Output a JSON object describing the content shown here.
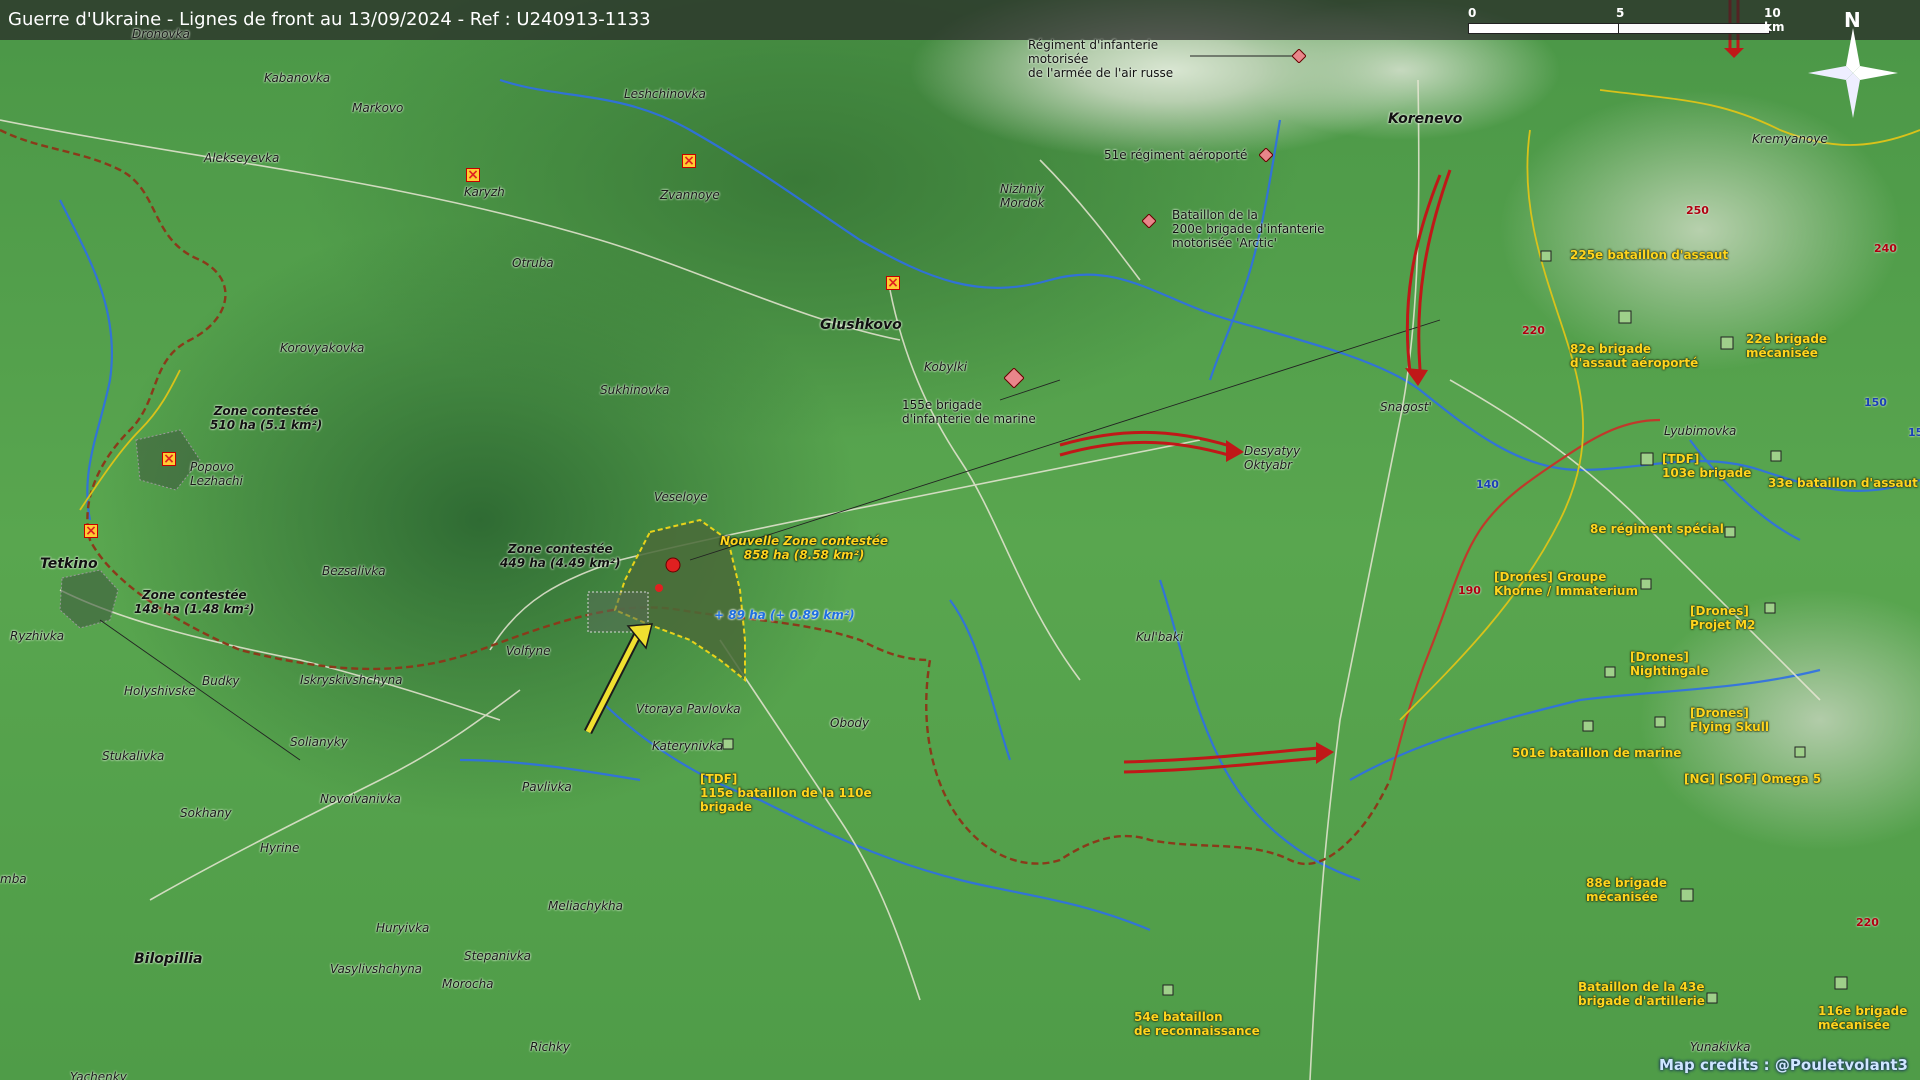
{
  "title": "Guerre d'Ukraine - Lignes de front au 13/09/2024 - Ref : U240913-1133",
  "scale": {
    "t0": "0",
    "t5": "5",
    "t10": "10 km"
  },
  "compass": {
    "label": "N"
  },
  "credit": "Map credits : @Pouletvolant3",
  "places": {
    "dronovka": "Dronovka",
    "kabanovka": "Kabanovka",
    "markovo": "Markovo",
    "leshchinovka": "Leshchinovka",
    "alekseyevka": "Alekseyevka",
    "karyzh": "Karyzh",
    "zvannoye": "Zvannoye",
    "otruba": "Otruba",
    "korovyakovka": "Korovyakovka",
    "glushkovo": "Glushkovo",
    "kobylki": "Kobylki",
    "sukhinovka": "Sukhinovka",
    "popovo": "Popovo\nLezhachi",
    "tetkino": "Tetkino",
    "ryzhivka": "Ryzhivka",
    "bezsalivka": "Bezsalivka",
    "veseloye": "Veseloye",
    "volfyne": "Volfyne",
    "holyshivske": "Holyshivske",
    "budky": "Budky",
    "iskryskivshchyna": "Iskryskivshchyna",
    "vtoraya": "Vtoraya Pavlovka",
    "katerynivka": "Katerynivka",
    "obody": "Obody",
    "solianyky": "Solianyky",
    "stukalivka": "Stukalivka",
    "pavlivka": "Pavlivka",
    "novoivanivka": "Novoivanivka",
    "sokhany": "Sokhany",
    "hyrine": "Hyrine",
    "meliachykha": "Meliachykha",
    "huryivka": "Huryivka",
    "bilopillia": "Bilopillia",
    "stepanivka": "Stepanivka",
    "vasylivshchyna": "Vasylivshchyna",
    "morocha": "Morocha",
    "richky": "Richky",
    "yachenky": "Yachenky",
    "mba": "mba",
    "korenevo": "Korenevo",
    "kremyanoye": "Kremyanoye",
    "nizhniy": "Nizhniy\nMordok",
    "snagost": "Snagost'",
    "desyatyy": "Desyatyy\nOktyabr",
    "lyubimovka": "Lyubimovka",
    "kulbaki": "Kul'baki",
    "yunakivka": "Yunakivka"
  },
  "zones": {
    "z1": "Zone contestée\n510 ha (5.1 km²)",
    "z2": "Zone contestée\n148 ha (1.48 km²)",
    "z3": "Zone contestée\n449 ha (4.49 km²)",
    "new_zone": "Nouvelle Zone contestée\n858 ha (8.58 km²)",
    "gain": "+ 89 ha (+ 0.89 km²)"
  },
  "units_ru": {
    "u1": "Régiment d'infanterie\nmotorisée\nde l'armée de l'air russe",
    "u2": "51e régiment aéroporté",
    "u3": "Bataillon de la\n200e brigade d'infanterie\nmotorisée 'Arctic'",
    "u4": "155e brigade\nd'infanterie de marine"
  },
  "units_ua": {
    "a1": "225e bataillon d'assaut",
    "a2": "82e brigade\nd'assaut aéroporté",
    "a3": "22e brigade\nmécanisée",
    "a4": "[TDF]\n103e brigade",
    "a5": "33e bataillon d'assaut",
    "a6": "8e régiment spécial",
    "a7": "[Drones] Groupe\nKhorne / Immaterium",
    "a8": "[Drones]\nProjet M2",
    "a9": "[Drones]\nNightingale",
    "a10": "[Drones]\nFlying Skull",
    "a11": "501e bataillon de marine",
    "a12": "[NG] [SOF] Omega 5",
    "a13": "88e brigade\nmécanisée",
    "a14": "Bataillon de la 43e\nbrigade d'artillerie",
    "a15": "116e brigade\nmécanisée",
    "a16": "54e bataillon\nde reconnaissance",
    "a17": "[TDF]\n115e bataillon de la 110e\nbrigade"
  },
  "elevations": {
    "e250": "250",
    "e240": "240",
    "e220a": "220",
    "e220b": "220",
    "e150a": "150",
    "e150b": "15",
    "e140": "140",
    "e190": "190"
  },
  "colors": {
    "front_line": "#c0392b",
    "ru_unit": "#e8868a",
    "ua_unit": "#9fd08a",
    "ua_text": "#ffd51e",
    "river": "#2f6fe6",
    "road": "#f0f0e0"
  }
}
